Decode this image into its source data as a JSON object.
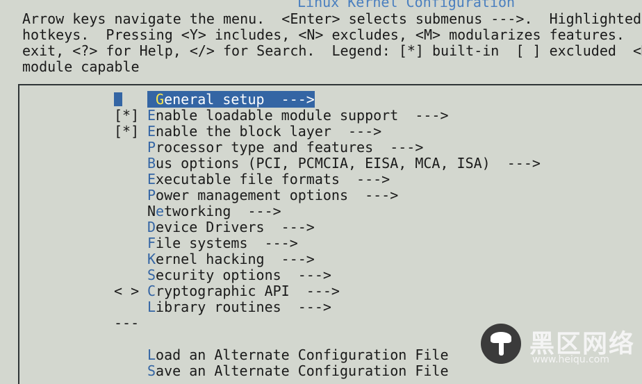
{
  "title": "Linux Kernel Configuration",
  "help_lines": [
    "Arrow keys navigate the menu.  <Enter> selects submenus --->.  Highlighted letters are",
    "hotkeys.  Pressing <Y> includes, <N> excludes, <M> modularizes features.  Press <Esc><Esc> to",
    "exit, <?> for Help, </> for Search.  Legend: [*] built-in  [ ] excluded  <M> module  < >",
    "module capable"
  ],
  "menu": {
    "items": [
      {
        "prefix": "",
        "hotkey": "G",
        "rest": "eneral setup  --->",
        "selected": true
      },
      {
        "prefix": "[*]",
        "hotkey": "E",
        "rest": "nable loadable module support  --->"
      },
      {
        "prefix": "[*]",
        "hotkey": "E",
        "rest": "nable the block layer  --->"
      },
      {
        "prefix": "",
        "hotkey": "P",
        "rest": "rocessor type and features  --->"
      },
      {
        "prefix": "",
        "hotkey": "B",
        "rest": "us options (PCI, PCMCIA, EISA, MCA, ISA)  --->"
      },
      {
        "prefix": "",
        "hotkey": "E",
        "rest": "xecutable file formats  --->"
      },
      {
        "prefix": "",
        "hotkey": "P",
        "rest": "ower management options  --->"
      },
      {
        "prefix": "",
        "lead": "N",
        "hotkey": "e",
        "rest": "tworking  --->"
      },
      {
        "prefix": "",
        "hotkey": "D",
        "rest": "evice Drivers  --->"
      },
      {
        "prefix": "",
        "hotkey": "F",
        "rest": "ile systems  --->"
      },
      {
        "prefix": "",
        "hotkey": "K",
        "rest": "ernel hacking  --->"
      },
      {
        "prefix": "",
        "hotkey": "S",
        "rest": "ecurity options  --->"
      },
      {
        "prefix": "< >",
        "hotkey": "C",
        "rest": "ryptographic API  --->"
      },
      {
        "prefix": "",
        "hotkey": "L",
        "rest": "ibrary routines  --->"
      }
    ],
    "separator": "---",
    "actions": [
      {
        "hotkey": "L",
        "rest": "oad an Alternate Configuration File"
      },
      {
        "hotkey": "S",
        "rest": "ave an Alternate Configuration File"
      }
    ]
  },
  "watermark": {
    "brand": "黑区网络",
    "url": "www.heiqu.com"
  },
  "colors": {
    "background": "#d3d7cf",
    "highlight": "#3465a4",
    "hotkey": "#3465a4",
    "title": "#4a7fbf"
  }
}
